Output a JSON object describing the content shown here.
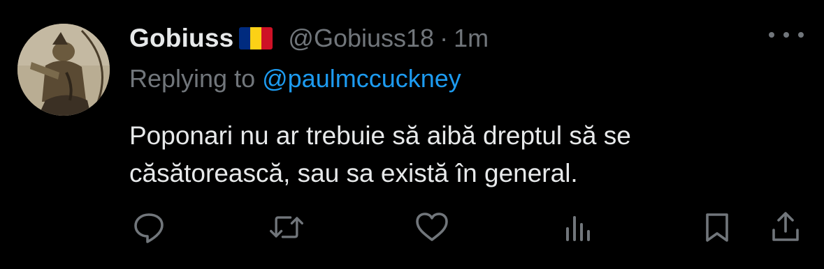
{
  "tweet": {
    "display_name": "Gobiuss",
    "flag_icon": "romania-flag-icon",
    "flag_colors": [
      "#002b7f",
      "#fcd116",
      "#ce1126"
    ],
    "handle": "@Gobiuss18",
    "separator": "·",
    "timestamp": "1m",
    "reply_prefix": "Replying to ",
    "reply_to": "@paulmccuckney",
    "text_line1": "Poponari nu ar trebuie să aibă dreptul să se",
    "text_line2": "căsătorească, sau sa există în general."
  },
  "actions": [
    {
      "name": "reply-icon"
    },
    {
      "name": "retweet-icon"
    },
    {
      "name": "like-icon"
    },
    {
      "name": "views-icon"
    },
    {
      "name": "bookmark-icon"
    },
    {
      "name": "share-icon"
    }
  ],
  "colors": {
    "background": "#000000",
    "primary_text": "#e7e9ea",
    "secondary_text": "#71767b",
    "link": "#1d9bf0"
  }
}
